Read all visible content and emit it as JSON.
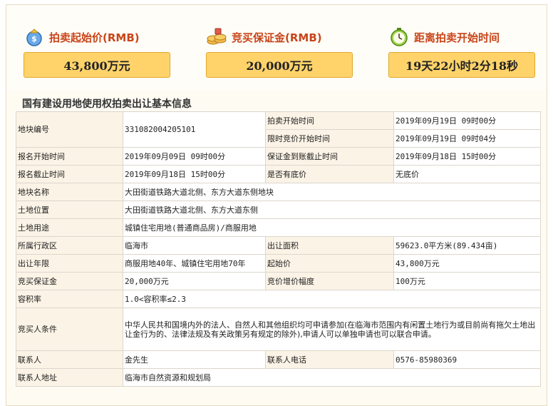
{
  "summary": {
    "start_price": {
      "label": "拍卖起始价(RMB)",
      "value": "43,800万元",
      "icon": "money-bag-icon"
    },
    "deposit": {
      "label": "竞买保证金(RMB)",
      "value": "20,000万元",
      "icon": "coins-icon"
    },
    "countdown": {
      "label": "距离拍卖开始时间",
      "value": "19天22小时2分18秒",
      "icon": "clock-icon"
    }
  },
  "section_title": "国有建设用地使用权拍卖出让基本信息",
  "table": {
    "parcel_no": {
      "label": "地块编号",
      "value": "331082004205101"
    },
    "auction_start": {
      "label": "拍卖开始时间",
      "value": "2019年09月19日 09时00分"
    },
    "limited_bid_start": {
      "label": "限时竞价开始时间",
      "value": "2019年09月19日 09时04分"
    },
    "registration_start": {
      "label": "报名开始时间",
      "value": "2019年09月09日 09时00分"
    },
    "deposit_deadline": {
      "label": "保证金到账截止时间",
      "value": "2019年09月18日 15时00分"
    },
    "registration_end": {
      "label": "报名截止时间",
      "value": "2019年09月18日 15时00分"
    },
    "reserve_price": {
      "label": "是否有底价",
      "value": "无底价"
    },
    "parcel_name": {
      "label": "地块名称",
      "value": "大田街道铁路大道北侧、东方大道东侧地块"
    },
    "location": {
      "label": "土地位置",
      "value": "大田街道铁路大道北侧、东方大道东侧"
    },
    "land_use": {
      "label": "土地用途",
      "value": "城镇住宅用地(普通商品房)/商服用地"
    },
    "district": {
      "label": "所属行政区",
      "value": "临海市"
    },
    "area": {
      "label": "出让面积",
      "value": "59623.0平方米(89.434亩)"
    },
    "term": {
      "label": "出让年限",
      "value": "商服用地40年、城镇住宅用地70年"
    },
    "starting_price": {
      "label": "起始价",
      "value": "43,800万元"
    },
    "bid_deposit": {
      "label": "竞买保证金",
      "value": "20,000万元"
    },
    "increment": {
      "label": "竞价增价幅度",
      "value": "100万元"
    },
    "far": {
      "label": "容积率",
      "value": "1.0<容积率≤2.3"
    },
    "bidder_conditions": {
      "label": "竞买人条件",
      "value": "中华人民共和国境内外的法人、自然人和其他组织均可申请参加(在临海市范围内有闲置土地行为或目前尚有拖欠土地出让金行为的、法律法规及有关政策另有规定的除外),申请人可以单独申请也可以联合申请。"
    },
    "contact": {
      "label": "联系人",
      "value": "金先生"
    },
    "contact_phone": {
      "label": "联系人电话",
      "value": "0576-85980369"
    },
    "contact_address": {
      "label": "联系人地址",
      "value": "临海市自然资源和规划局"
    }
  }
}
